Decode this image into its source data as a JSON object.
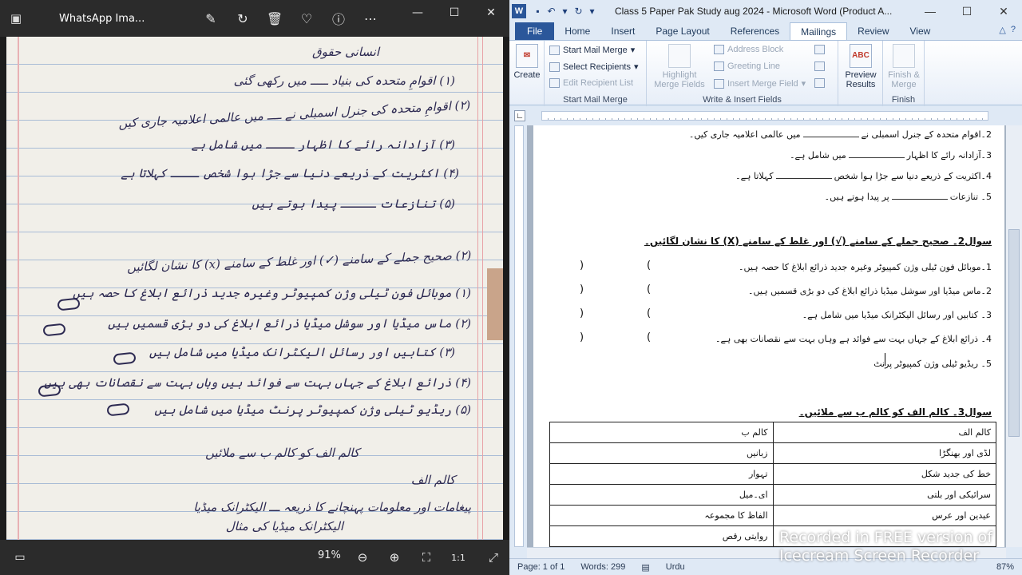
{
  "viewer": {
    "title": "WhatsApp Ima...",
    "zoom": "91%",
    "handwriting": [
      "انسانی حقوق",
      "(۱) اقوامِ متحدہ کی بنیاد ـــــ میں رکھی گئی",
      "(۲) اقوامِ متحدہ کی جنرل اسمبلی نے ــــ میں عالمی اعلامیہ جاری کیں",
      "(۳) آزادانہ رائے کا اظہار ــــ میں شامل ہے",
      "(۴) اکثریت کے ذریعے دنیا سے جڑا ہوا شخص ــــ کہلاتا ہے",
      "(۵) تنازعات ـــــ پیدا ہوتے ہیں",
      "(۲) صحیح جملے کے سامنے (✓) اور غلط کے سامنے (x) کا نشان لگائیں",
      "(۱) موبائل فون ٹیلی وژن کمپیوٹر وغیرہ جدید ذرائع ابلاغ کا حصہ ہیں",
      "(۲) ماس میڈیا اور سوشل میڈیا ذرائع ابلاغ کی دو بڑی قسمیں ہیں",
      "(۳) کتابیں اور رسائل الیکٹرانک میڈیا میں شامل ہیں",
      "(۴) ذرائع ابلاغ کے جہاں بہت سے فوائد ہیں وہاں بہت سے نقصانات بھی ہیں",
      "(۵) ریڈیو ٹیلی وژن کمپیوٹر پرنٹ میڈیا میں شامل ہیں",
      "کالم الف کو کالم ب سے ملائیں",
      "کالم الف",
      "پیغامات اور معلومات پہنچانے کا ذریعہ ـــ الیکٹرانک میڈیا",
      "الیکٹرانک میڈیا کی مثال"
    ]
  },
  "word": {
    "title": "Class 5 Paper Pak Study aug 2024  -  Microsoft Word (Product A...",
    "logo": "W",
    "tabs": [
      "File",
      "Home",
      "Insert",
      "Page Layout",
      "References",
      "Mailings",
      "Review",
      "View"
    ],
    "ribbon": {
      "create": "Create",
      "start_mail_merge": "Start Mail Merge",
      "select_recipients": "Select Recipients",
      "edit_recipient_list": "Edit Recipient List",
      "group_start": "Start Mail Merge",
      "highlight": "Highlight\nMerge Fields",
      "address_block": "Address Block",
      "greeting_line": "Greeting Line",
      "insert_merge_field": "Insert Merge Field",
      "group_write": "Write & Insert Fields",
      "preview": "Preview\nResults",
      "finish": "Finish &\nMerge",
      "group_finish": "Finish",
      "preview_icon": "ABC"
    },
    "doc": {
      "q1_lines": [
        "2۔اقوام متحدہ کے جنرل اسمبلی نے",
        "میں عالمی اعلامیہ جاری کیں۔",
        "3۔آزادانہ رائے کا اظہار",
        "میں شامل ہے۔",
        "4۔اکثریت کے ذریعے دنیا سے جڑا ہوا شخص",
        "کہلاتا ہے۔",
        "5۔ تنازعات",
        "پر پیدا ہوتے ہیں۔"
      ],
      "q2_head": "سوال2۔ صحیح جملے کے سامنے (√) اور غلط کے سامنے (X) کا نشان لگائیں۔",
      "q2_lines": [
        "1۔موبائل فون ٹیلی وژن کمپیوٹر وغیرہ جدید ذرائع ابلاغ کا حصہ ہیں۔",
        "2۔ماس میڈیا اور سوشل میڈیا ذرائع ابلاغ کی دو بڑی قسمیں ہیں۔",
        "3۔ کتابیں اور رسائل الیکٹرانک میڈیا میں شامل ہے۔",
        "4۔ ذرائع ابلاغ کے جہاں بہت سے فوائد ہے وہاں بہت سے نقصانات بھی ہے۔",
        "5۔ ریڈیو ٹیلی وژن کمپیوٹر پرنٹ"
      ],
      "q3_head": "سوال3۔ کالم الف کو کالم ب سے ملائیں۔",
      "table": [
        [
          "کالم الف",
          "کالم ب"
        ],
        [
          "لڈی اور بھنگڑا",
          "زبانیں"
        ],
        [
          "خط کی جدید شکل",
          "تہوار"
        ],
        [
          "سرائیکی اور بلتی",
          "ای۔میل"
        ],
        [
          "عیدین اور عرس",
          "الفاظ کا مجموعہ"
        ],
        [
          "",
          "روایتی رقص"
        ]
      ]
    },
    "status": {
      "page": "Page: 1 of 1",
      "words": "Words: 299",
      "language": "Urdu",
      "zoom": "87%"
    }
  },
  "watermark": {
    "line1": "Recorded in FREE version of",
    "line2": "Icecream  Screen  Recorder"
  }
}
